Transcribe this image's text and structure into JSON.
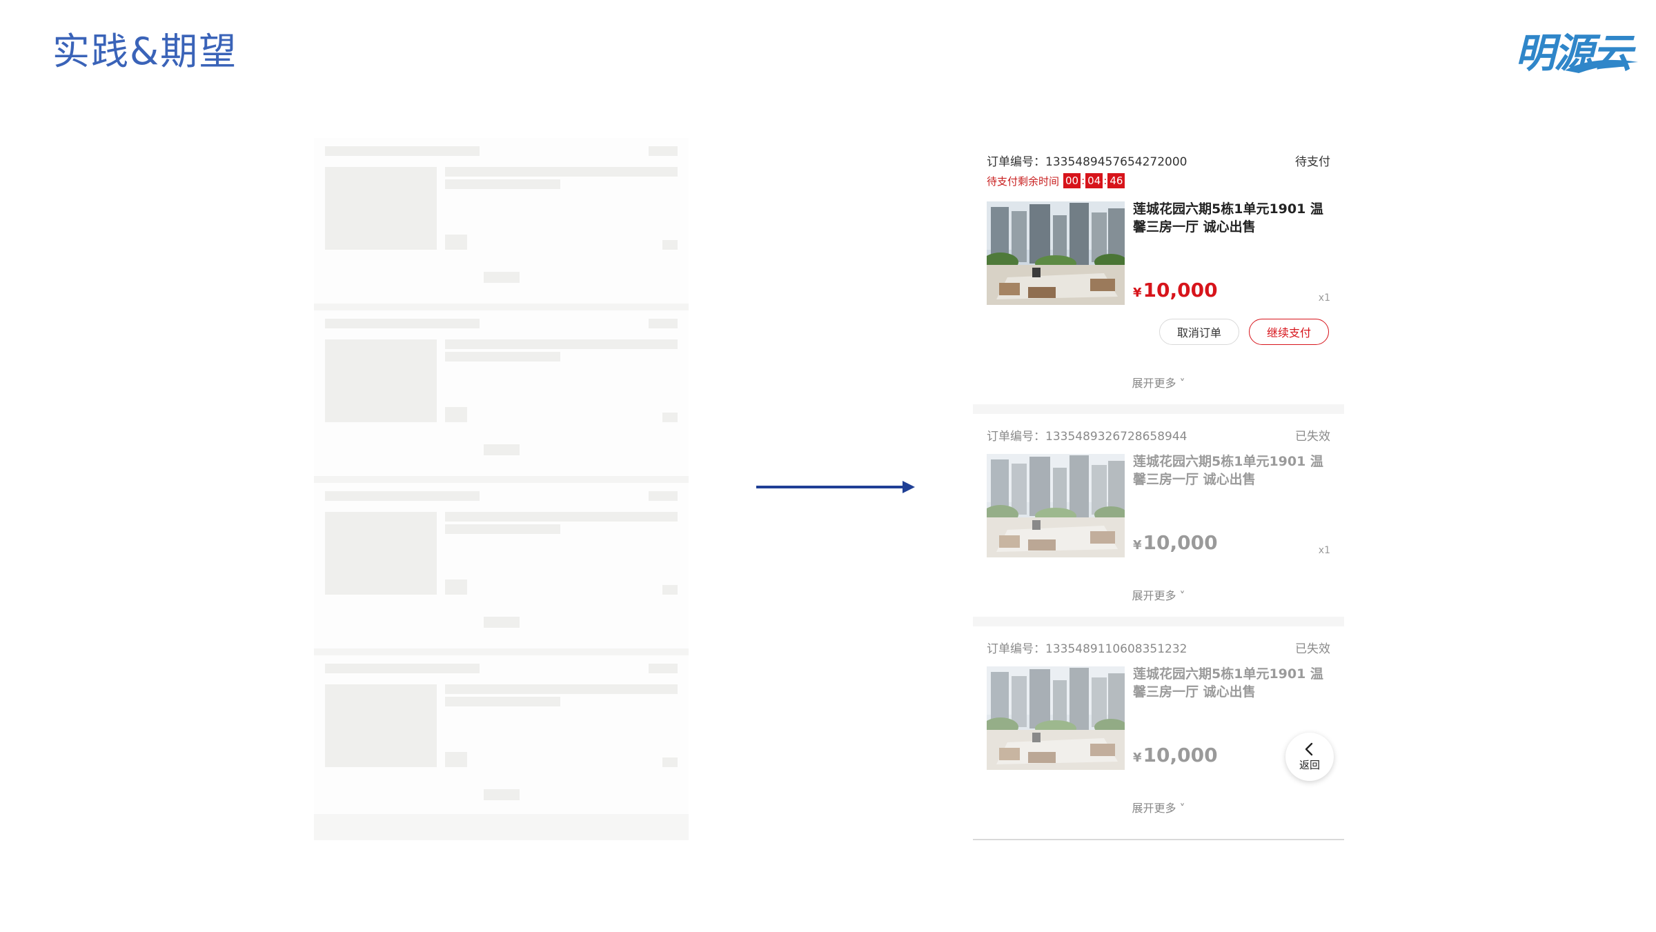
{
  "slide": {
    "title": "实践&期望"
  },
  "logo": {
    "text": "明源云"
  },
  "orders": [
    {
      "order_no": "订单编号：1335489457654272000",
      "status": "待支付",
      "countdown": {
        "label": "待支付剩余时间",
        "h": "00",
        "m": "04",
        "s": "46"
      },
      "title": "莲城花园六期5栋1单元1901 温馨三房一厅 诚心出售",
      "currency": "¥",
      "price": "10,000",
      "qty": "x1",
      "cancel_label": "取消订单",
      "pay_label": "继续支付",
      "expand_label": "展开更多 ˅"
    },
    {
      "order_no": "订单编号：1335489326728658944",
      "status": "已失效",
      "title": "莲城花园六期5栋1单元1901 温馨三房一厅 诚心出售",
      "currency": "¥",
      "price": "10,000",
      "qty": "x1",
      "expand_label": "展开更多 ˅"
    },
    {
      "order_no": "订单编号：1335489110608351232",
      "status": "已失效",
      "title": "莲城花园六期5栋1单元1901 温馨三房一厅 诚心出售",
      "currency": "¥",
      "price": "10,000",
      "expand_label": "展开更多 ˅"
    }
  ],
  "back_button": {
    "label": "返回"
  },
  "colors": {
    "title_blue": "#3a63b8",
    "accent_red": "#d7141b",
    "logo_blue": "#2f86c9",
    "arrow_blue": "#1f3f95"
  }
}
